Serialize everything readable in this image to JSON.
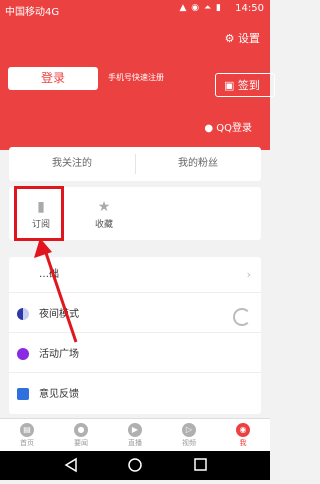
{
  "status": {
    "carrier": "中国移动4G",
    "time": "14:50",
    "icons": "▲ ◉ ⏶ ▮"
  },
  "header": {
    "settings_label": "设置",
    "login_label": "登录",
    "quick_register": "手机号快速注册",
    "checkin_label": "签到",
    "qq_login": "QQ登录",
    "bg_color": "#ec4141"
  },
  "follow_card": {
    "following": "我关注的",
    "fans": "我的粉丝"
  },
  "icon_card": {
    "subscribe": "订阅",
    "favorites": "收藏"
  },
  "list": [
    {
      "label": "…础",
      "icon": "chevron-right-icon"
    },
    {
      "label": "夜间模式",
      "icon": "moon-icon"
    },
    {
      "label": "活动广场",
      "icon": "balloon-icon"
    },
    {
      "label": "意见反馈",
      "icon": "feedback-icon"
    }
  ],
  "bottom_nav": [
    {
      "label": "首页",
      "active": false
    },
    {
      "label": "要闻",
      "active": false
    },
    {
      "label": "直播",
      "active": false
    },
    {
      "label": "视频",
      "active": false
    },
    {
      "label": "我",
      "active": true
    }
  ],
  "annotation_color": "#e0151d"
}
